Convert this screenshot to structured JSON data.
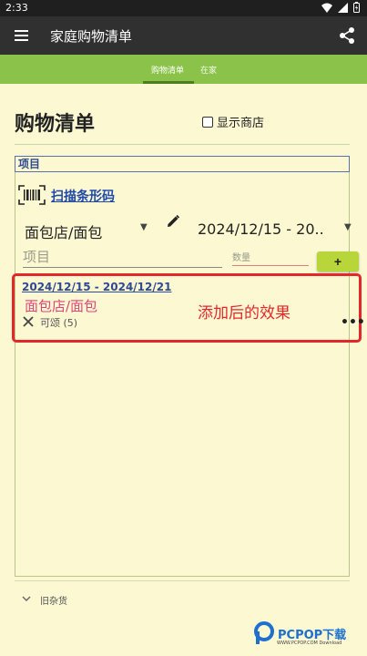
{
  "status_bar": {
    "time": "2:33"
  },
  "app_bar": {
    "title": "家庭购物清单"
  },
  "tabs": [
    {
      "label": "购物清单",
      "active": true
    },
    {
      "label": "在家",
      "active": false
    }
  ],
  "header": {
    "title": "购物清单",
    "show_store_label": "显示商店",
    "show_store_checked": false
  },
  "section_label": "项目",
  "scan": {
    "label": "扫描条形码"
  },
  "form": {
    "store_value": "面包店/面包",
    "date_value": "2024/12/15 - 20..",
    "item_placeholder": "项目",
    "quantity_placeholder": "数量",
    "add_label": "+"
  },
  "item_card": {
    "date_range": "2024/12/15 - 2024/12/21",
    "store": "面包店/面包",
    "item": "可颂 (5)",
    "annotation": "添加后的效果",
    "more_label": "•••"
  },
  "footer": {
    "old_groceries_label": "旧杂货"
  },
  "watermark": {
    "text": "PCPOP下载",
    "subtext": "WWW.PCPOP.COM Download"
  },
  "colors": {
    "app_bar": "#303030",
    "tab_bar": "#8bc34a",
    "background": "#fbf8d2",
    "accent_link": "#1f49a8",
    "highlight_red": "#e3272b",
    "add_button": "#b8d53a"
  }
}
